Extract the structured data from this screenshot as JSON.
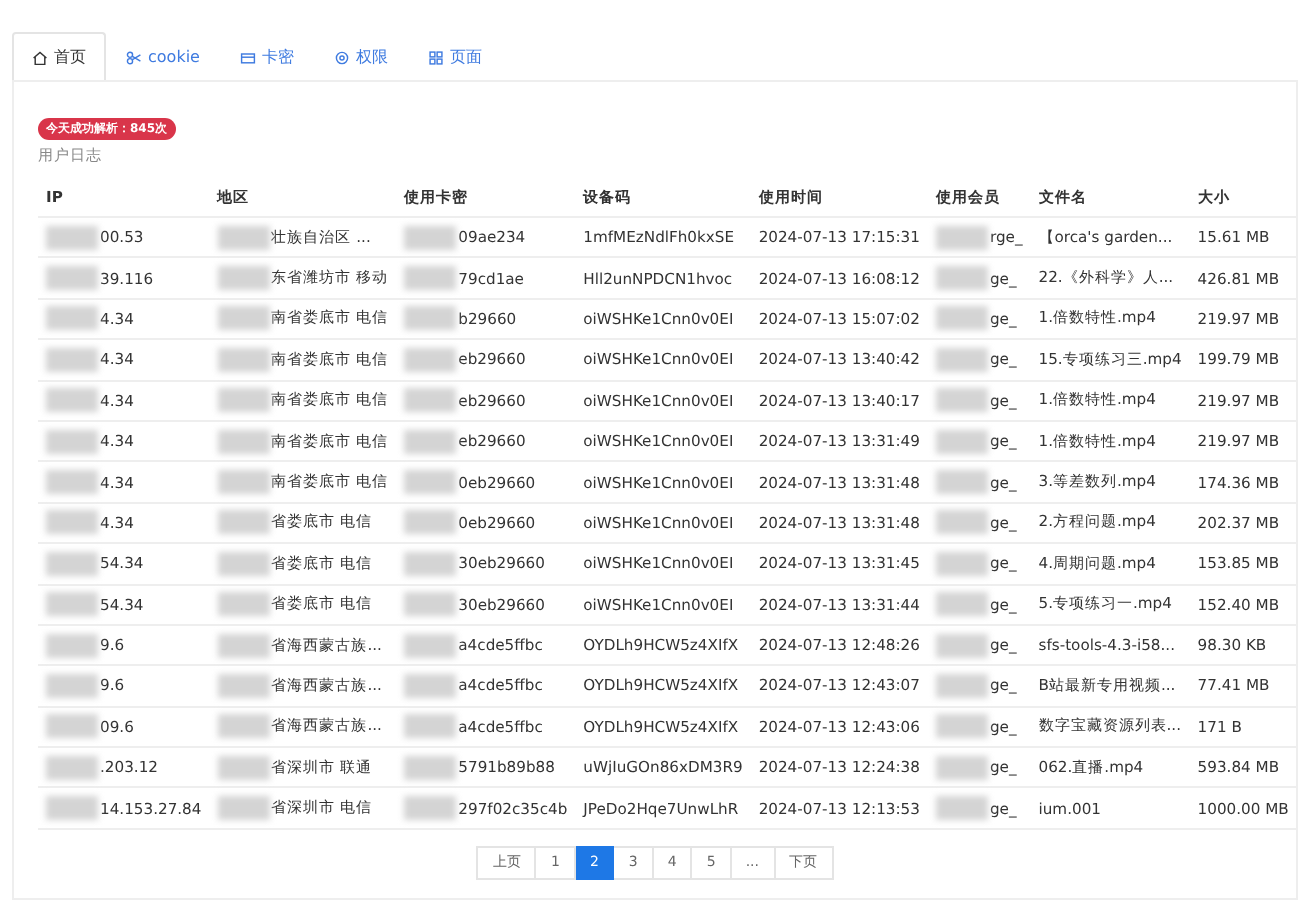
{
  "tabs": [
    {
      "label": "首页",
      "selected": true
    },
    {
      "label": "cookie",
      "selected": false
    },
    {
      "label": "卡密",
      "selected": false
    },
    {
      "label": "权限",
      "selected": false
    },
    {
      "label": "页面",
      "selected": false
    }
  ],
  "badge": "今天成功解析：845次",
  "section_title": "用户日志",
  "table": {
    "columns": [
      {
        "label": "IP",
        "redacted": true
      },
      {
        "label": "地区",
        "redacted": true
      },
      {
        "label": "使用卡密",
        "redacted": true
      },
      {
        "label": "设备码",
        "redacted": false
      },
      {
        "label": "使用时间",
        "redacted": false
      },
      {
        "label": "使用会员",
        "redacted": true
      },
      {
        "label": "文件名",
        "redacted": false
      },
      {
        "label": "大小",
        "redacted": false
      }
    ],
    "rows": [
      [
        "00.53",
        "壮族自治区 ...",
        "09ae234",
        "1mfMEzNdlFh0kxSE",
        "2024-07-13 17:15:31",
        "rge_",
        "【orca's garden...",
        "15.61 MB"
      ],
      [
        "39.116",
        "东省潍坊市 移动",
        "79cd1ae",
        "Hll2unNPDCN1hvoc",
        "2024-07-13 16:08:12",
        "ge_",
        "22.《外科学》人...",
        "426.81 MB"
      ],
      [
        "4.34",
        "南省娄底市 电信",
        "b29660",
        "oiWSHKe1Cnn0v0EI",
        "2024-07-13 15:07:02",
        "ge_",
        "1.倍数特性.mp4",
        "219.97 MB"
      ],
      [
        "4.34",
        "南省娄底市 电信",
        "eb29660",
        "oiWSHKe1Cnn0v0EI",
        "2024-07-13 13:40:42",
        "ge_",
        "15.专项练习三.mp4",
        "199.79 MB"
      ],
      [
        "4.34",
        "南省娄底市 电信",
        "eb29660",
        "oiWSHKe1Cnn0v0EI",
        "2024-07-13 13:40:17",
        "ge_",
        "1.倍数特性.mp4",
        "219.97 MB"
      ],
      [
        "4.34",
        "南省娄底市 电信",
        "eb29660",
        "oiWSHKe1Cnn0v0EI",
        "2024-07-13 13:31:49",
        "ge_",
        "1.倍数特性.mp4",
        "219.97 MB"
      ],
      [
        "4.34",
        "南省娄底市 电信",
        "0eb29660",
        "oiWSHKe1Cnn0v0EI",
        "2024-07-13 13:31:48",
        "ge_",
        "3.等差数列.mp4",
        "174.36 MB"
      ],
      [
        "4.34",
        "省娄底市 电信",
        "0eb29660",
        "oiWSHKe1Cnn0v0EI",
        "2024-07-13 13:31:48",
        "ge_",
        "2.方程问题.mp4",
        "202.37 MB"
      ],
      [
        "54.34",
        "省娄底市 电信",
        "30eb29660",
        "oiWSHKe1Cnn0v0EI",
        "2024-07-13 13:31:45",
        "ge_",
        "4.周期问题.mp4",
        "153.85 MB"
      ],
      [
        "54.34",
        "省娄底市 电信",
        "30eb29660",
        "oiWSHKe1Cnn0v0EI",
        "2024-07-13 13:31:44",
        "ge_",
        "5.专项练习一.mp4",
        "152.40 MB"
      ],
      [
        "9.6",
        "省海西蒙古族...",
        "a4cde5ffbc",
        "OYDLh9HCW5z4XIfX",
        "2024-07-13 12:48:26",
        "ge_",
        "sfs-tools-4.3-i58...",
        "98.30 KB"
      ],
      [
        "9.6",
        "省海西蒙古族...",
        "a4cde5ffbc",
        "OYDLh9HCW5z4XIfX",
        "2024-07-13 12:43:07",
        "ge_",
        "B站最新专用视频...",
        "77.41 MB"
      ],
      [
        "09.6",
        "省海西蒙古族...",
        "a4cde5ffbc",
        "OYDLh9HCW5z4XIfX",
        "2024-07-13 12:43:06",
        "ge_",
        "数字宝藏资源列表...",
        "171 B"
      ],
      [
        ".203.12",
        "省深圳市 联通",
        "5791b89b88",
        "uWjIuGOn86xDM3R9",
        "2024-07-13 12:24:38",
        "ge_",
        "062.直播.mp4",
        "593.84 MB"
      ],
      [
        "14.153.27.84",
        "省深圳市 电信",
        "297f02c35c4b",
        "JPeDo2Hqe7UnwLhR",
        "2024-07-13 12:13:53",
        "ge_",
        "ium.001",
        "1000.00 MB"
      ]
    ]
  },
  "pagination": [
    {
      "label": "上页",
      "selected": false
    },
    {
      "label": "1",
      "selected": false
    },
    {
      "label": "2",
      "selected": true
    },
    {
      "label": "3",
      "selected": false
    },
    {
      "label": "4",
      "selected": false
    },
    {
      "label": "5",
      "selected": false
    },
    {
      "label": "...",
      "selected": false
    },
    {
      "label": "下页",
      "selected": false
    }
  ]
}
